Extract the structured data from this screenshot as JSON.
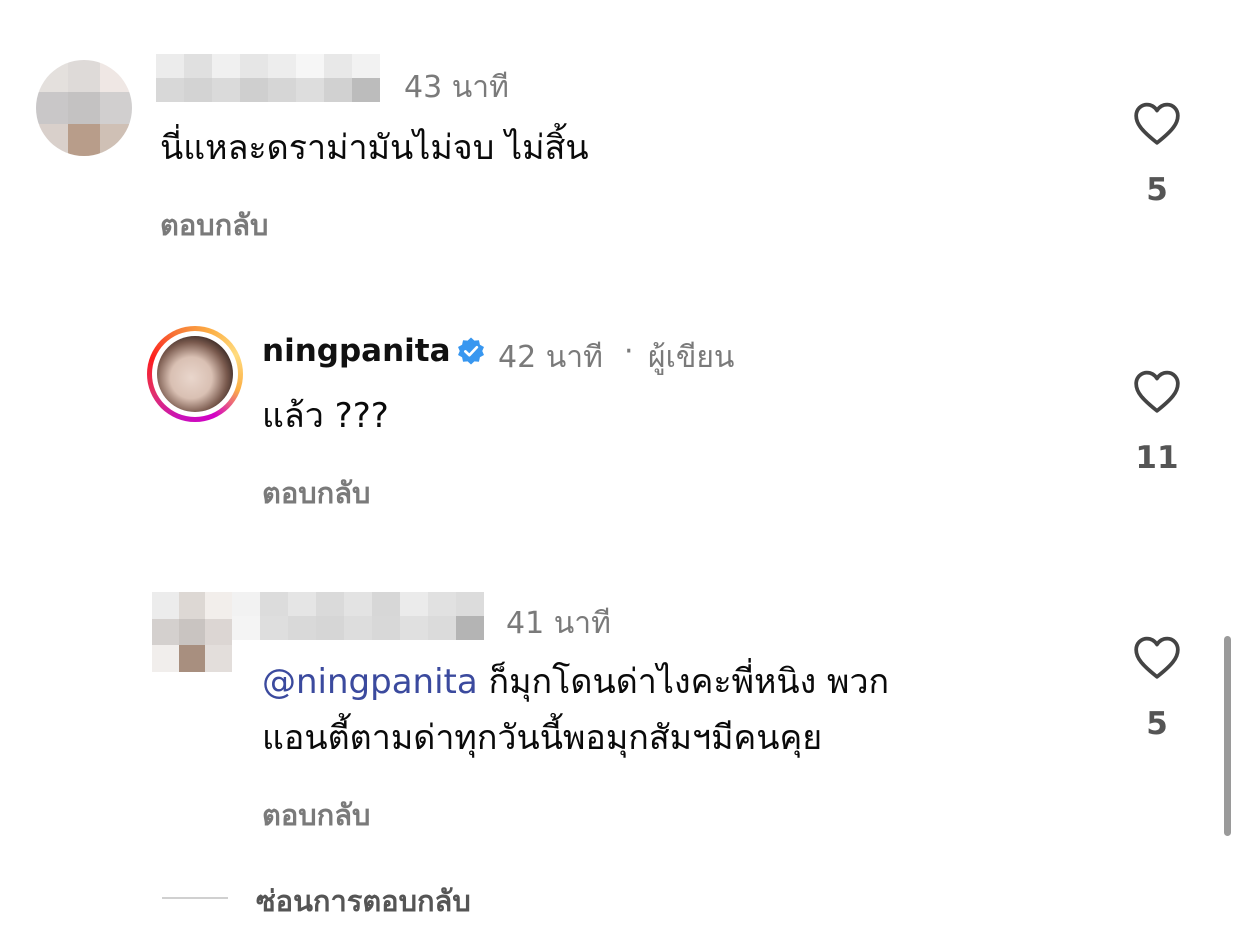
{
  "comments": [
    {
      "username": "",
      "time": "43 นาที",
      "text": "นี่แหละดราม่ามันไม่จบ ไม่สิ้น",
      "reply_label": "ตอบกลับ",
      "likes": "5"
    },
    {
      "username": "ningpanita",
      "verified": true,
      "time": "42 นาที",
      "separator": "·",
      "author_badge": "ผู้เขียน",
      "text": "แล้ว ???",
      "reply_label": "ตอบกลับ",
      "likes": "11"
    },
    {
      "username": "",
      "time": "41 นาที",
      "mention": "@ningpanita",
      "text_line1": "ก็มุกโดนด่าไงคะพี่หนิง พวก",
      "text_line2": "แอนตี้ตามด่าทุกวันนี้พอมุกสัมฯมีคนคุย",
      "reply_label": "ตอบกลับ",
      "likes": "5"
    }
  ],
  "hide_replies_label": "ซ่อนการตอบกลับ",
  "colors": {
    "mention": "#3b4a9e",
    "verified": "#3897f0",
    "meta_gray": "#7a7a7a"
  },
  "icons": [
    "heart-icon",
    "verified-badge-icon"
  ]
}
